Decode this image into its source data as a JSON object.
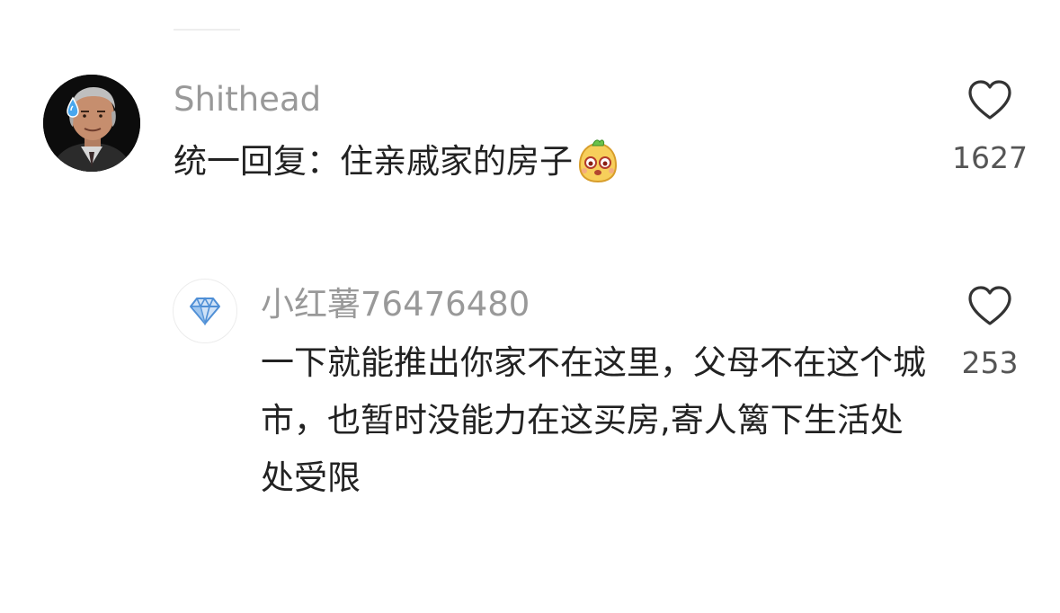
{
  "comments": [
    {
      "username": "Shithead",
      "text": "统一回复：住亲戚家的房子",
      "emoji": "bear-face-emoji",
      "likes": "1627",
      "avatar": "man-portrait-avatar"
    },
    {
      "username": "小红薯76476480",
      "text": "一下就能推出你家不在这里，父母不在这个城市，也暂时没能力在这买房,寄人篱下生活处处受限",
      "likes": "253",
      "avatar": "diamond-icon"
    }
  ],
  "colors": {
    "username": "#999999",
    "text": "#222222",
    "like_count": "#555555",
    "diamond": "#6aa6e8"
  }
}
